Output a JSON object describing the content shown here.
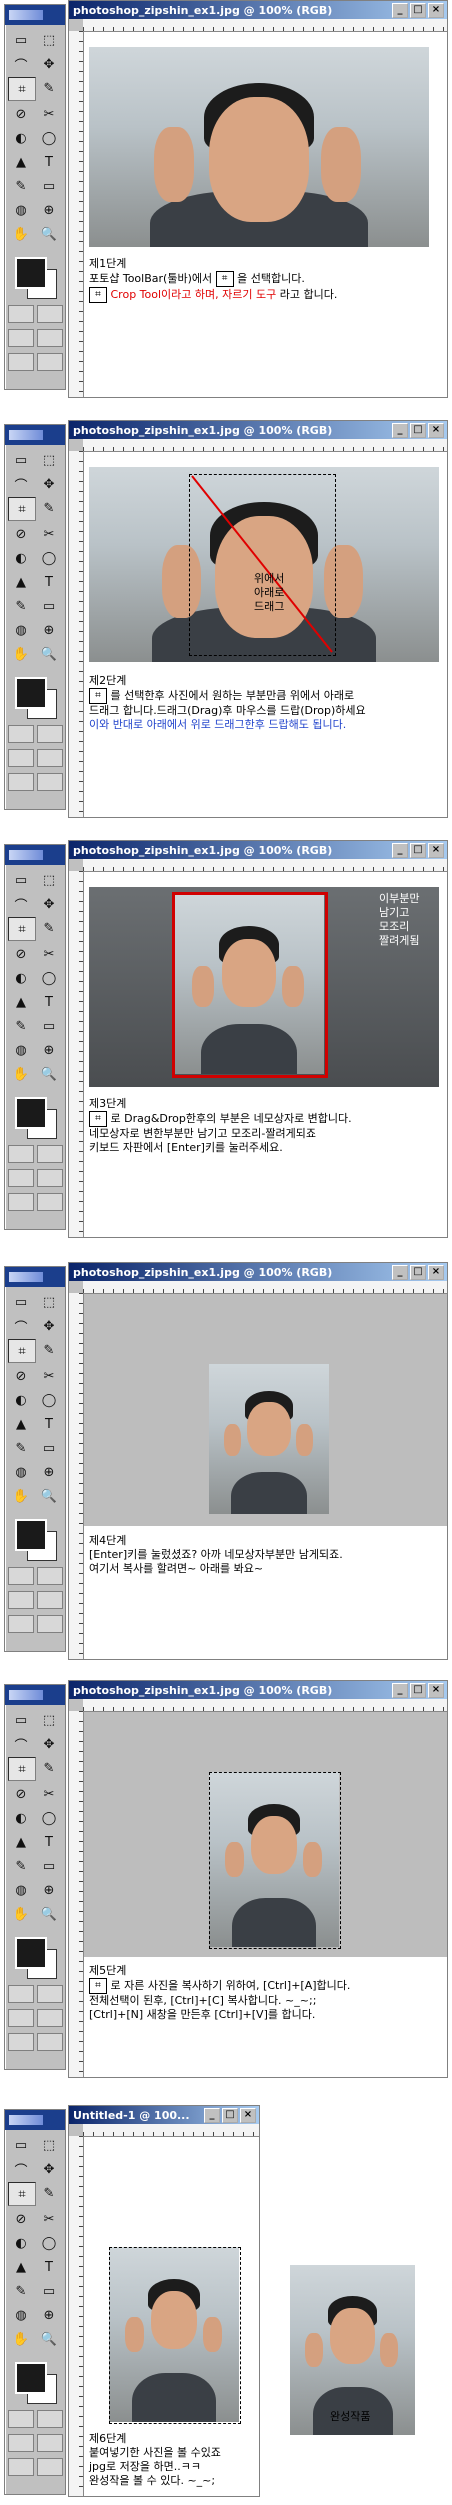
{
  "panels": [
    {
      "title": "photoshop_zipshin_ex1.jpg @ 100% (RGB)",
      "step_label": "제1단계",
      "lines": [
        "포토샵 ToolBar(툴바)에서",
        "을 선택합니다.",
        "Crop Tool이라고 하며,",
        "자르기 도구",
        "라고 합니다."
      ]
    },
    {
      "title": "photoshop_zipshin_ex1.jpg @ 100% (RGB)",
      "overlay_text": [
        "위에서",
        "아래로",
        "드래그"
      ],
      "step_label": "제2단계",
      "lines": [
        "를 선택한후 사진에서 원하는 부분만큼 위에서 아래로",
        "드래그 합니다.드래그(Drag)후 마우스를 드랍(Drop)하세요",
        "이와 반대로 아래에서 위로 드래그한후 드랍해도 됩니다."
      ]
    },
    {
      "title": "photoshop_zipshin_ex1.jpg @ 100% (RGB)",
      "overlay_text": [
        "이부분만",
        "남기고",
        "모조리",
        "짤려게됨"
      ],
      "step_label": "제3단계",
      "lines": [
        "로 Drag&Drop한후의 부분은 네모상자로 변합니다.",
        "네모상자로 변한부분만 남기고 모조리-짤려게되죠",
        "키보드 자판에서 [Enter]키를 눌러주세요."
      ]
    },
    {
      "title": "photoshop_zipshin_ex1.jpg @ 100% (RGB)",
      "step_label": "제4단계",
      "lines": [
        "[Enter]키를 눌렀셨죠? 아까 네모상자부분만 남게되죠.",
        "여기서 복사를 할려면~ 아래를 봐요~"
      ]
    },
    {
      "title": "photoshop_zipshin_ex1.jpg @ 100% (RGB)",
      "step_label": "제5단계",
      "lines": [
        "로 자른 사진을 복사하기 위하여, [Ctrl]+[A]합니다.",
        "전체선택이 된후, [Ctrl]+[C] 복사합니다. ~_~;;",
        "[Ctrl]+[N] 새창을 만든후 [Ctrl]+[V]를 합니다."
      ]
    },
    {
      "title": "Untitled-1 @ 100...",
      "result_label": "완성작품",
      "step_label": "제6단계",
      "lines": [
        "붙여넣기한 사진을 볼 수있죠",
        "jpg로 저장을 하면..ㅋㅋ",
        "완성작을 볼 수 있다. ~_~;"
      ]
    }
  ],
  "toolbox": {
    "tools": [
      "▭",
      "⬚",
      "⌒",
      "✥",
      "⌗",
      "✎",
      "⊘",
      "✂",
      "◐",
      "◯",
      "▲",
      "T",
      "✎",
      "▭",
      "◍",
      "⊕",
      "✋",
      "🔍"
    ]
  },
  "window_buttons": [
    "_",
    "□",
    "×"
  ],
  "colors": {
    "title_start": "#0a246a",
    "accent_red": "#e00000",
    "accent_blue": "#2244cc"
  }
}
